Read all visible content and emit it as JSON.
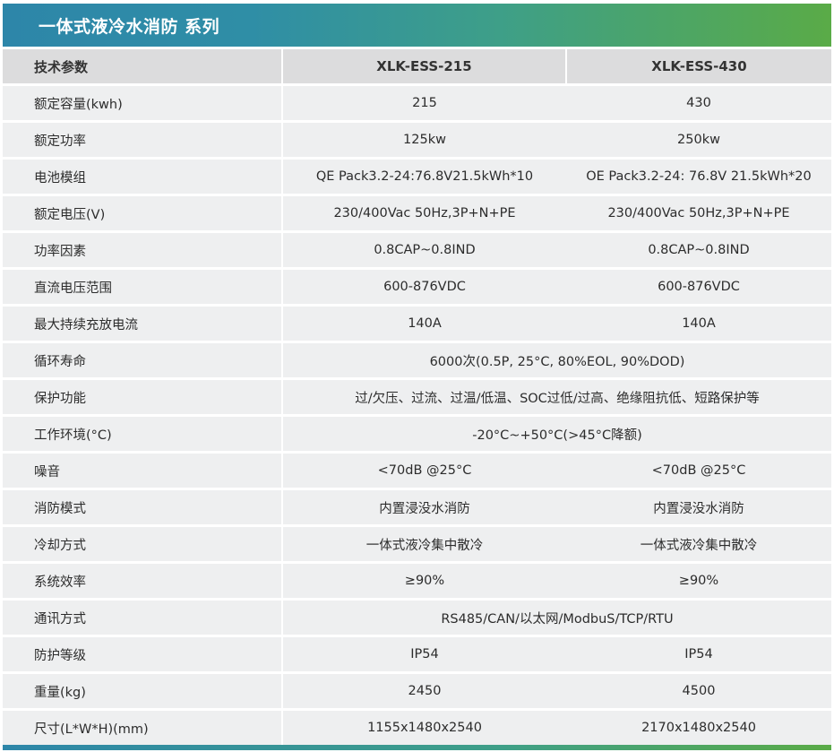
{
  "title": "一体式液冷水消防 系列",
  "table": {
    "header": {
      "label": "技术参数",
      "model_1": "XLK-ESS-215",
      "model_2": "XLK-ESS-430"
    },
    "rows": [
      {
        "label": "额定容量(kwh)",
        "v1": "215",
        "v2": "430"
      },
      {
        "label": "额定功率",
        "v1": "125kw",
        "v2": "250kw"
      },
      {
        "label": "电池模组",
        "v1": "QE Pack3.2-24:76.8V21.5kWh*10",
        "v2": "OE Pack3.2-24: 76.8V 21.5kWh*20"
      },
      {
        "label": "额定电压(V)",
        "v1": "230/400Vac 50Hz,3P+N+PE",
        "v2": "230/400Vac 50Hz,3P+N+PE"
      },
      {
        "label": "功率因素",
        "v1": "0.8CAP~0.8IND",
        "v2": "0.8CAP~0.8IND"
      },
      {
        "label": "直流电压范围",
        "v1": "600-876VDC",
        "v2": "600-876VDC"
      },
      {
        "label": "最大持续充放电流",
        "v1": "140A",
        "v2": "140A"
      },
      {
        "label": "循环寿命",
        "merged": "6000次(0.5P, 25°C, 80%EOL, 90%DOD)"
      },
      {
        "label": "保护功能",
        "merged": "过/欠压、过流、过温/低温、SOC过低/过高、绝缘阻抗低、短路保护等"
      },
      {
        "label": "工作环境(°C)",
        "merged": "-20°C~+50°C(>45°C降额)"
      },
      {
        "label": "噪音",
        "v1": "<70dB @25°C",
        "v2": "<70dB @25°C"
      },
      {
        "label": "消防模式",
        "v1": "内置浸没水消防",
        "v2": "内置浸没水消防"
      },
      {
        "label": "冷却方式",
        "v1": "一体式液冷集中散冷",
        "v2": "一体式液冷集中散冷"
      },
      {
        "label": "系统效率",
        "v1": "≥90%",
        "v2": "≥90%"
      },
      {
        "label": "通讯方式",
        "merged": "RS485/CAN/以太网/ModbuS/TCP/RTU"
      },
      {
        "label": "防护等级",
        "v1": "IP54",
        "v2": "IP54"
      },
      {
        "label": "重量(kg)",
        "v1": "2450",
        "v2": "4500"
      },
      {
        "label": "尺寸(L*W*H)(mm)",
        "v1": "1155x1480x2540",
        "v2": "2170x1480x2540"
      }
    ]
  },
  "colors": {
    "title_gradient_start": "#2d86a9",
    "title_gradient_end": "#5aab47",
    "header_bg": "#dcdcdd",
    "row_bg": "#eeeff0"
  }
}
